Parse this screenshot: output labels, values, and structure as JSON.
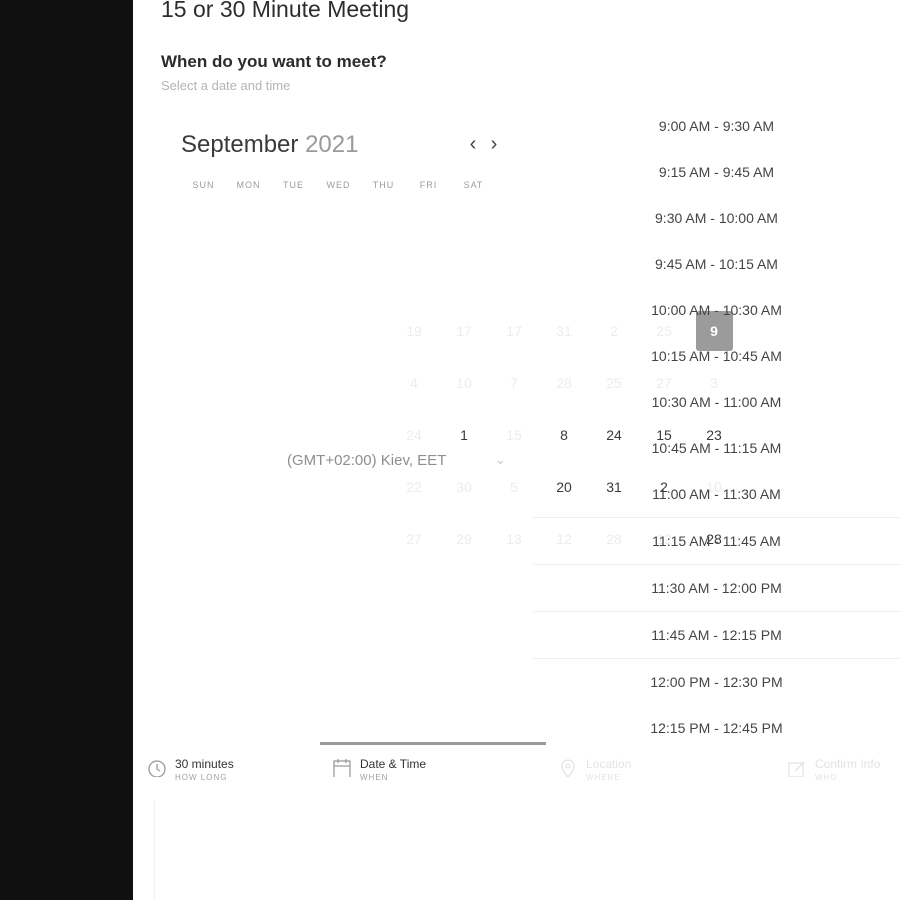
{
  "page": {
    "title": "15 or 30 Minute Meeting",
    "question": "When do you want to meet?",
    "subtitle": "Select a date and time"
  },
  "calendar": {
    "month": "September",
    "year": "2021",
    "weekdays": [
      "SUN",
      "MON",
      "TUE",
      "WED",
      "THU",
      "FRI",
      "SAT"
    ],
    "days_visible": [
      [
        "19",
        "17",
        "17",
        "31",
        "2",
        "25",
        "9"
      ],
      [
        "4",
        "10",
        "7",
        "28",
        "25",
        "27",
        "3"
      ],
      [
        "24",
        "1",
        "15",
        "8",
        "24",
        "15",
        "23"
      ],
      [
        "22",
        "30",
        "5",
        "20",
        "31",
        "2",
        "10"
      ],
      [
        "27",
        "29",
        "13",
        "12",
        "28",
        "12",
        "28"
      ]
    ],
    "selected_day": "9",
    "timezone": "(GMT+02:00) Kiev, EET"
  },
  "time_slots": [
    "9:00 AM - 9:30 AM",
    "9:15 AM - 9:45 AM",
    "9:30 AM - 10:00 AM",
    "9:45 AM - 10:15 AM",
    "10:00 AM - 10:30 AM",
    "10:15 AM - 10:45 AM",
    "10:30 AM - 11:00 AM",
    "10:45 AM - 11:15 AM",
    "11:00 AM - 11:30 AM",
    "11:15 AM - 11:45 AM",
    "11:30 AM - 12:00 PM",
    "11:45 AM - 12:15 PM",
    "12:00 PM - 12:30 PM",
    "12:15 PM - 12:45 PM"
  ],
  "steps": [
    {
      "label": "30 minutes",
      "sub": "HOW LONG",
      "icon": "clock-icon"
    },
    {
      "label": "Date & Time",
      "sub": "WHEN",
      "icon": "calendar-icon"
    },
    {
      "label": "Location",
      "sub": "WHERE",
      "icon": "location-pin-icon"
    },
    {
      "label": "Confirm Info",
      "sub": "WHO",
      "icon": "edit-icon"
    }
  ],
  "colors": {
    "sidebar": "#101010",
    "selected_day": "#9b9b9b",
    "progress": "#9a9a9a"
  }
}
